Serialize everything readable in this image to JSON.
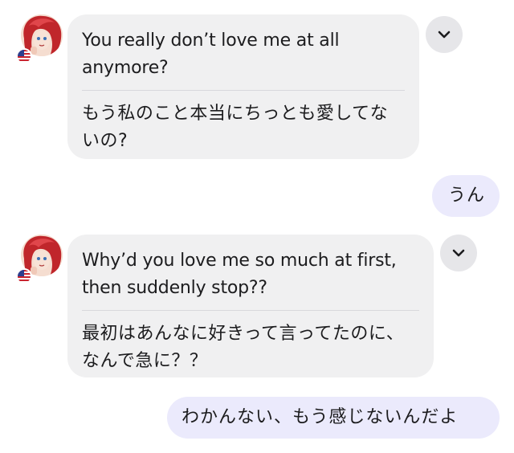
{
  "messages": [
    {
      "from": "partner",
      "original": "You really don’t love me at all anymore?",
      "translation": "もう私のこと本当にちっとも愛してないの?"
    },
    {
      "from": "me",
      "text": "うん"
    },
    {
      "from": "partner",
      "original": "Why’d you love me so much at first, then suddenly stop??",
      "translation": "最初はあんなに好きって言ってたのに、なんで急に？？"
    },
    {
      "from": "me",
      "text": "わかんない、もう感じないんだよ"
    }
  ],
  "icons": {
    "expand": "chevron-down-icon",
    "flag": "us-flag-icon"
  },
  "colors": {
    "partner_bubble": "#f0f0f1",
    "my_bubble": "#ebeafc",
    "expand_button": "#e6e6e9",
    "avatar_hair": "#c0262b"
  }
}
